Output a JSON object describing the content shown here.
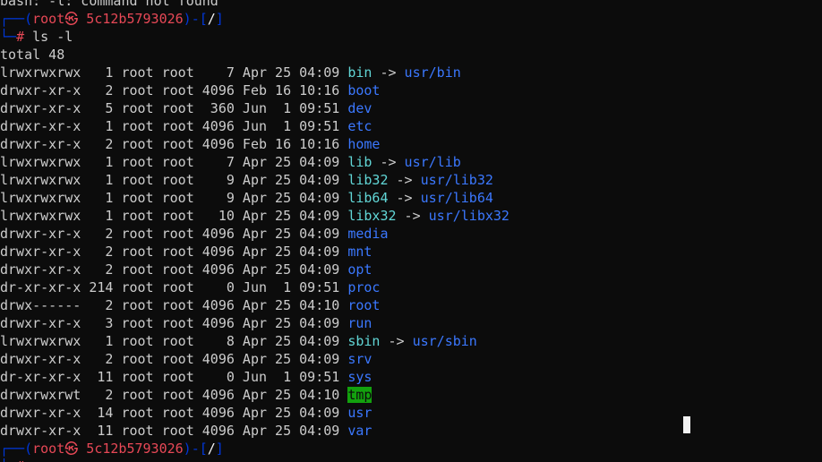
{
  "terminal": {
    "lines": [
      {
        "type": "text",
        "segments": [
          {
            "t": "bash: -l: command not found",
            "c": "default"
          }
        ]
      },
      {
        "type": "prompt_top",
        "segments": [
          {
            "t": "┌──(",
            "c": "prompt"
          },
          {
            "t": "root",
            "c": "red"
          },
          {
            "t": "㉿",
            "c": "red"
          },
          {
            "t": " 5c12b5793026",
            "c": "red"
          },
          {
            "t": ")-[",
            "c": "prompt"
          },
          {
            "t": "/",
            "c": "white"
          },
          {
            "t": "]",
            "c": "prompt"
          }
        ]
      },
      {
        "type": "prompt_cmd",
        "segments": [
          {
            "t": "└─",
            "c": "prompt"
          },
          {
            "t": "#",
            "c": "red"
          },
          {
            "t": " ls -l",
            "c": "default"
          }
        ]
      },
      {
        "type": "text",
        "segments": [
          {
            "t": "total 48",
            "c": "default"
          }
        ]
      },
      {
        "type": "entry",
        "segments": [
          {
            "t": "lrwxrwxrwx   1 root root    7 Apr 25 04:09 ",
            "c": "default"
          },
          {
            "t": "bin",
            "c": "link"
          },
          {
            "t": " -> ",
            "c": "default"
          },
          {
            "t": "usr/bin",
            "c": "dir"
          }
        ]
      },
      {
        "type": "entry",
        "segments": [
          {
            "t": "drwxr-xr-x   2 root root 4096 Feb 16 10:16 ",
            "c": "default"
          },
          {
            "t": "boot",
            "c": "dir"
          }
        ]
      },
      {
        "type": "entry",
        "segments": [
          {
            "t": "drwxr-xr-x   5 root root  360 Jun  1 09:51 ",
            "c": "default"
          },
          {
            "t": "dev",
            "c": "dir"
          }
        ]
      },
      {
        "type": "entry",
        "segments": [
          {
            "t": "drwxr-xr-x   1 root root 4096 Jun  1 09:51 ",
            "c": "default"
          },
          {
            "t": "etc",
            "c": "dir"
          }
        ]
      },
      {
        "type": "entry",
        "segments": [
          {
            "t": "drwxr-xr-x   2 root root 4096 Feb 16 10:16 ",
            "c": "default"
          },
          {
            "t": "home",
            "c": "dir"
          }
        ]
      },
      {
        "type": "entry",
        "segments": [
          {
            "t": "lrwxrwxrwx   1 root root    7 Apr 25 04:09 ",
            "c": "default"
          },
          {
            "t": "lib",
            "c": "link"
          },
          {
            "t": " -> ",
            "c": "default"
          },
          {
            "t": "usr/lib",
            "c": "dir"
          }
        ]
      },
      {
        "type": "entry",
        "segments": [
          {
            "t": "lrwxrwxrwx   1 root root    9 Apr 25 04:09 ",
            "c": "default"
          },
          {
            "t": "lib32",
            "c": "link"
          },
          {
            "t": " -> ",
            "c": "default"
          },
          {
            "t": "usr/lib32",
            "c": "dir"
          }
        ]
      },
      {
        "type": "entry",
        "segments": [
          {
            "t": "lrwxrwxrwx   1 root root    9 Apr 25 04:09 ",
            "c": "default"
          },
          {
            "t": "lib64",
            "c": "link"
          },
          {
            "t": " -> ",
            "c": "default"
          },
          {
            "t": "usr/lib64",
            "c": "dir"
          }
        ]
      },
      {
        "type": "entry",
        "segments": [
          {
            "t": "lrwxrwxrwx   1 root root   10 Apr 25 04:09 ",
            "c": "default"
          },
          {
            "t": "libx32",
            "c": "link"
          },
          {
            "t": " -> ",
            "c": "default"
          },
          {
            "t": "usr/libx32",
            "c": "dir"
          }
        ]
      },
      {
        "type": "entry",
        "segments": [
          {
            "t": "drwxr-xr-x   2 root root 4096 Apr 25 04:09 ",
            "c": "default"
          },
          {
            "t": "media",
            "c": "dir"
          }
        ]
      },
      {
        "type": "entry",
        "segments": [
          {
            "t": "drwxr-xr-x   2 root root 4096 Apr 25 04:09 ",
            "c": "default"
          },
          {
            "t": "mnt",
            "c": "dir"
          }
        ]
      },
      {
        "type": "entry",
        "segments": [
          {
            "t": "drwxr-xr-x   2 root root 4096 Apr 25 04:09 ",
            "c": "default"
          },
          {
            "t": "opt",
            "c": "dir"
          }
        ]
      },
      {
        "type": "entry",
        "segments": [
          {
            "t": "dr-xr-xr-x 214 root root    0 Jun  1 09:51 ",
            "c": "default"
          },
          {
            "t": "proc",
            "c": "dir"
          }
        ]
      },
      {
        "type": "entry",
        "segments": [
          {
            "t": "drwx------   2 root root 4096 Apr 25 04:10 ",
            "c": "default"
          },
          {
            "t": "root",
            "c": "dir"
          }
        ]
      },
      {
        "type": "entry",
        "segments": [
          {
            "t": "drwxr-xr-x   3 root root 4096 Apr 25 04:09 ",
            "c": "default"
          },
          {
            "t": "run",
            "c": "dir"
          }
        ]
      },
      {
        "type": "entry",
        "segments": [
          {
            "t": "lrwxrwxrwx   1 root root    8 Apr 25 04:09 ",
            "c": "default"
          },
          {
            "t": "sbin",
            "c": "link"
          },
          {
            "t": " -> ",
            "c": "default"
          },
          {
            "t": "usr/sbin",
            "c": "dir"
          }
        ]
      },
      {
        "type": "entry",
        "segments": [
          {
            "t": "drwxr-xr-x   2 root root 4096 Apr 25 04:09 ",
            "c": "default"
          },
          {
            "t": "srv",
            "c": "dir"
          }
        ]
      },
      {
        "type": "entry",
        "segments": [
          {
            "t": "dr-xr-xr-x  11 root root    0 Jun  1 09:51 ",
            "c": "default"
          },
          {
            "t": "sys",
            "c": "dir"
          }
        ]
      },
      {
        "type": "entry",
        "segments": [
          {
            "t": "drwxrwxrwt   2 root root 4096 Apr 25 04:10 ",
            "c": "default"
          },
          {
            "t": "tmp",
            "c": "tmp"
          }
        ]
      },
      {
        "type": "entry",
        "segments": [
          {
            "t": "drwxr-xr-x  14 root root 4096 Apr 25 04:09 ",
            "c": "default"
          },
          {
            "t": "usr",
            "c": "dir"
          }
        ]
      },
      {
        "type": "entry",
        "segments": [
          {
            "t": "drwxr-xr-x  11 root root 4096 Apr 25 04:09 ",
            "c": "default"
          },
          {
            "t": "var",
            "c": "dir"
          }
        ]
      },
      {
        "type": "prompt_top",
        "segments": [
          {
            "t": "┌──(",
            "c": "prompt"
          },
          {
            "t": "root",
            "c": "red"
          },
          {
            "t": "㉿",
            "c": "red"
          },
          {
            "t": " 5c12b5793026",
            "c": "red"
          },
          {
            "t": ")-[",
            "c": "prompt"
          },
          {
            "t": "/",
            "c": "white"
          },
          {
            "t": "]",
            "c": "prompt"
          }
        ]
      },
      {
        "type": "prompt_cmd",
        "segments": [
          {
            "t": "└─",
            "c": "prompt"
          },
          {
            "t": "#",
            "c": "red"
          },
          {
            "t": " ",
            "c": "default"
          }
        ]
      }
    ],
    "colors": {
      "background": "#0c0c0c",
      "default": "#cccccc",
      "dir": "#3b78ff",
      "link": "#61d6d6",
      "red": "#e74856",
      "prompt": "#0037da",
      "white": "#f2f2f2",
      "tmp_highlight": "#13a10e"
    }
  }
}
